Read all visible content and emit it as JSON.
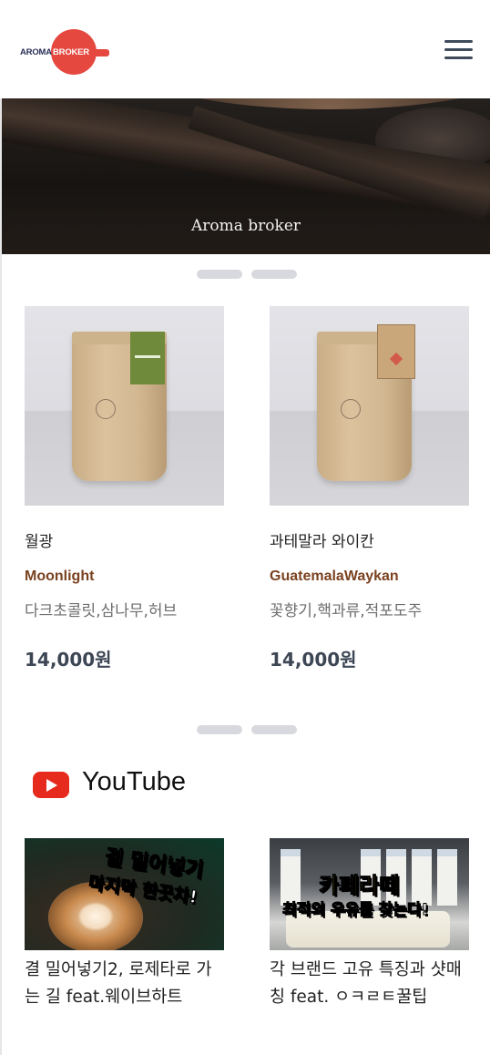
{
  "header": {
    "logo_word1": "AROMA",
    "logo_word2": "BROKER",
    "menu_icon": "hamburger-menu-icon",
    "logo_color": "#e5483f"
  },
  "hero": {
    "caption": "Aroma broker"
  },
  "products": [
    {
      "name_ko": "월광",
      "name_en": "Moonlight",
      "notes": "다크초콜릿,삼나무,허브",
      "price": "14,000원"
    },
    {
      "name_ko": "과테말라 와이칸",
      "name_en": "GuatemalaWaykan",
      "notes": "꽃향기,핵과류,적포도주",
      "price": "14,000원"
    }
  ],
  "youtube": {
    "section_title": "YouTube",
    "icon": "youtube-icon",
    "videos": [
      {
        "thumb_line1": "결 밀어넣기",
        "thumb_line2": "마지막 한끗차!",
        "title": "결 밀어넣기2, 로제타로 가는 길 feat.웨이브하트"
      },
      {
        "thumb_line1": "카페라떼",
        "thumb_line2": "최적의 우유를 찾는다!",
        "title": "각 브랜드 고유 특징과 샷매칭 feat. ㅇㅋㄹㅌ꿀팁"
      }
    ]
  },
  "colors": {
    "accent": "#e5483f",
    "price": "#3d4654",
    "english_name": "#7a4220",
    "dot": "#d8d9de"
  }
}
